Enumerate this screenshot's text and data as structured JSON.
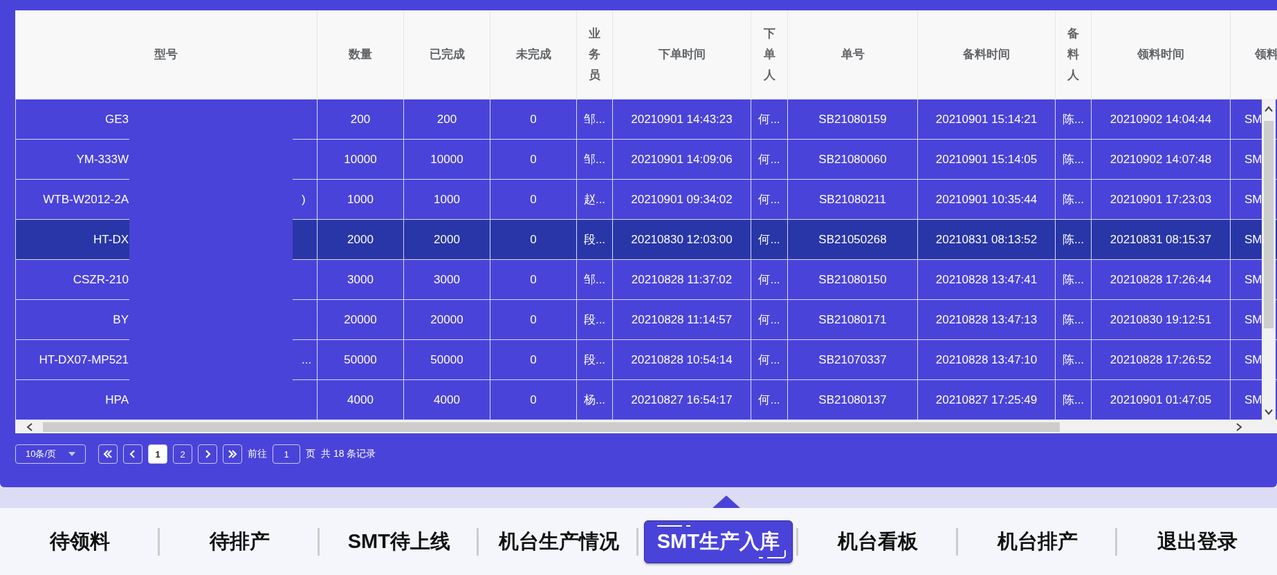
{
  "table": {
    "columns": [
      {
        "label": "型号",
        "narrow": false
      },
      {
        "label": "数量",
        "narrow": false
      },
      {
        "label": "已完成",
        "narrow": false
      },
      {
        "label": "未完成",
        "narrow": false
      },
      {
        "label": "业务员",
        "narrow": true
      },
      {
        "label": "下单时间",
        "narrow": false
      },
      {
        "label": "下单人",
        "narrow": true
      },
      {
        "label": "单号",
        "narrow": false
      },
      {
        "label": "备料时间",
        "narrow": false
      },
      {
        "label": "备料人",
        "narrow": true
      },
      {
        "label": "领料时间",
        "narrow": false
      },
      {
        "label": "领料",
        "narrow": false
      }
    ],
    "rows": [
      {
        "selected": false,
        "cells": [
          "GE3",
          "200",
          "200",
          "0",
          "邹...",
          "20210901 14:43:23",
          "何...",
          "SB21080159",
          "20210901 15:14:21",
          "陈...",
          "20210902 14:04:44",
          "SM"
        ],
        "model_tail": ""
      },
      {
        "selected": false,
        "cells": [
          "YM-333W",
          "10000",
          "10000",
          "0",
          "邹...",
          "20210901 14:09:06",
          "何...",
          "SB21080060",
          "20210901 15:14:05",
          "陈...",
          "20210902 14:07:48",
          "SM"
        ],
        "model_tail": ""
      },
      {
        "selected": false,
        "cells": [
          "WTB-W2012-2A",
          "1000",
          "1000",
          "0",
          "赵...",
          "20210901 09:34:02",
          "何...",
          "SB21080211",
          "20210901 10:35:44",
          "陈...",
          "20210901 17:23:03",
          "SM"
        ],
        "model_tail": ")"
      },
      {
        "selected": true,
        "cells": [
          "HT-DX",
          "2000",
          "2000",
          "0",
          "段...",
          "20210830 12:03:00",
          "何...",
          "SB21050268",
          "20210831 08:13:52",
          "陈...",
          "20210831 08:15:37",
          "SM"
        ],
        "model_tail": ""
      },
      {
        "selected": false,
        "cells": [
          "CSZR-210",
          "3000",
          "3000",
          "0",
          "邹...",
          "20210828 11:37:02",
          "何...",
          "SB21080150",
          "20210828 13:47:41",
          "陈...",
          "20210828 17:26:44",
          "SM"
        ],
        "model_tail": ""
      },
      {
        "selected": false,
        "cells": [
          "BY",
          "20000",
          "20000",
          "0",
          "段...",
          "20210828 11:14:57",
          "何...",
          "SB21080171",
          "20210828 13:47:13",
          "陈...",
          "20210830 19:12:51",
          "SM"
        ],
        "model_tail": ""
      },
      {
        "selected": false,
        "cells": [
          "HT-DX07-MP521",
          "50000",
          "50000",
          "0",
          "段...",
          "20210828 10:54:14",
          "何...",
          "SB21070337",
          "20210828 13:47:10",
          "陈...",
          "20210828 17:26:52",
          "SM"
        ],
        "model_tail": "..."
      },
      {
        "selected": false,
        "cells": [
          "HPA",
          "4000",
          "4000",
          "0",
          "杨...",
          "20210827 16:54:17",
          "何...",
          "SB21080137",
          "20210827 17:25:49",
          "陈...",
          "20210901 01:47:05",
          "SM"
        ],
        "model_tail": ""
      }
    ]
  },
  "pagination": {
    "page_size": "10条/页",
    "pages": [
      {
        "label": "1",
        "selected": true
      },
      {
        "label": "2",
        "selected": false
      }
    ],
    "goto_label": "前往",
    "goto_value": "1",
    "page_unit": "页",
    "total": "共 18 条记录"
  },
  "nav": [
    {
      "label": "待领料",
      "selected": false
    },
    {
      "label": "待排产",
      "selected": false
    },
    {
      "label": "SMT待上线",
      "selected": false
    },
    {
      "label": "机台生产情况",
      "selected": false
    },
    {
      "label": "SMT生产入库",
      "selected": true
    },
    {
      "label": "机台看板",
      "selected": false
    },
    {
      "label": "机台排产",
      "selected": false
    },
    {
      "label": "退出登录",
      "selected": false
    }
  ]
}
